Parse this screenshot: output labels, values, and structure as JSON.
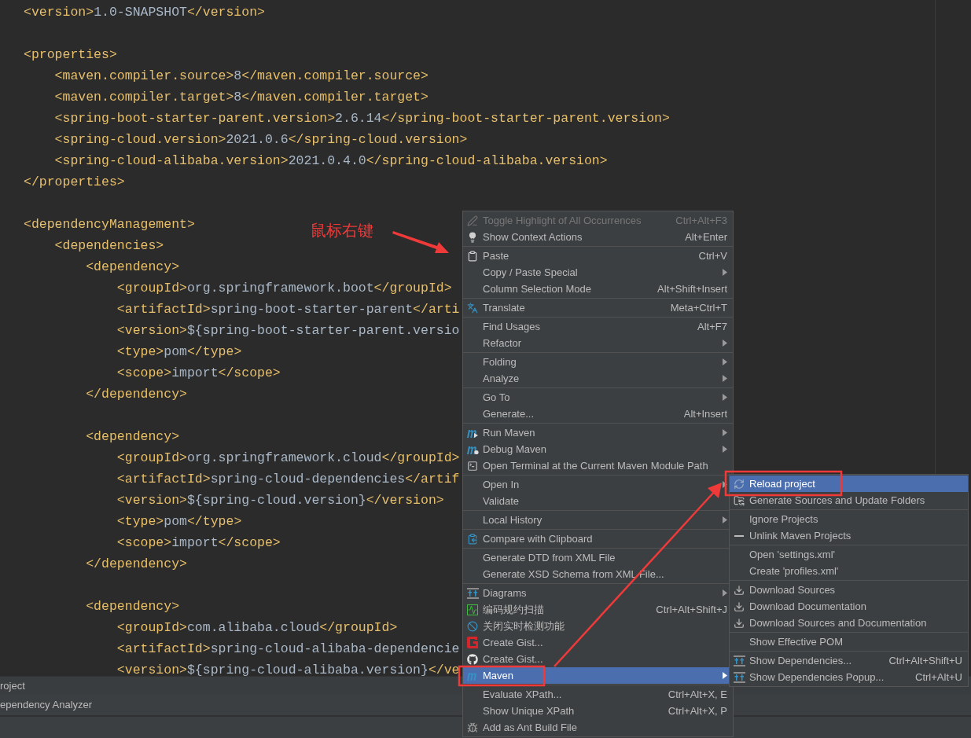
{
  "editor": {
    "blocks": [
      {
        "lines": [
          "<version>1.0-SNAPSHOT</version>"
        ]
      },
      {
        "lines": [
          "<properties>",
          "    <maven.compiler.source>8</maven.compiler.source>",
          "    <maven.compiler.target>8</maven.compiler.target>",
          "    <spring-boot-starter-parent.version>2.6.14</spring-boot-starter-parent.version>",
          "    <spring-cloud.version>2021.0.6</spring-cloud.version>",
          "    <spring-cloud-alibaba.version>2021.0.4.0</spring-cloud-alibaba.version>",
          "</properties>"
        ]
      },
      {
        "lines": [
          "<dependencyManagement>",
          "    <dependencies>",
          "        <dependency>",
          "            <groupId>org.springframework.boot</groupId>",
          "            <artifactId>spring-boot-starter-parent</arti",
          "            <version>${spring-boot-starter-parent.versio",
          "            <type>pom</type>",
          "            <scope>import</scope>",
          "        </dependency>"
        ]
      },
      {
        "lines": [
          "        <dependency>",
          "            <groupId>org.springframework.cloud</groupId>",
          "            <artifactId>spring-cloud-dependencies</artif",
          "            <version>${spring-cloud.version}</version>",
          "            <type>pom</type>",
          "            <scope>import</scope>",
          "        </dependency>"
        ]
      },
      {
        "lines": [
          "        <dependency>",
          "            <groupId>com.alibaba.cloud</groupId>",
          "            <artifactId>spring-cloud-alibaba-dependencie",
          "            <version>${spring-cloud-alibaba.version}</ve"
        ]
      }
    ]
  },
  "tool_windows": [
    {
      "label": "roject"
    },
    {
      "label": "ependency Analyzer"
    }
  ],
  "annotations": [
    {
      "text": "鼠标右键"
    }
  ],
  "context_menu": {
    "sections": [
      {
        "items": [
          {
            "label": "Toggle Highlight of All Occurrences",
            "shortcut": "Ctrl+Alt+F3",
            "submenu": false,
            "disabled": true,
            "selected": false
          },
          {
            "label": "Show Context Actions",
            "shortcut": "Alt+Enter",
            "submenu": false,
            "disabled": false,
            "selected": false
          }
        ]
      },
      {
        "items": [
          {
            "label": "Paste",
            "shortcut": "Ctrl+V",
            "submenu": false,
            "disabled": false,
            "selected": false
          },
          {
            "label": "Copy / Paste Special",
            "submenu": true,
            "disabled": false,
            "selected": false
          },
          {
            "label": "Column Selection Mode",
            "shortcut": "Alt+Shift+Insert",
            "submenu": false,
            "disabled": false,
            "selected": false
          }
        ]
      },
      {
        "items": [
          {
            "label": "Translate",
            "shortcut": "Meta+Ctrl+T",
            "submenu": false,
            "disabled": false,
            "selected": false
          }
        ]
      },
      {
        "items": [
          {
            "label": "Find Usages",
            "shortcut": "Alt+F7",
            "submenu": false,
            "disabled": false,
            "selected": false
          },
          {
            "label": "Refactor",
            "submenu": true,
            "disabled": false,
            "selected": false
          }
        ]
      },
      {
        "items": [
          {
            "label": "Folding",
            "submenu": true,
            "disabled": false,
            "selected": false
          },
          {
            "label": "Analyze",
            "submenu": true,
            "disabled": false,
            "selected": false
          }
        ]
      },
      {
        "items": [
          {
            "label": "Go To",
            "submenu": true,
            "disabled": false,
            "selected": false
          },
          {
            "label": "Generate...",
            "shortcut": "Alt+Insert",
            "submenu": false,
            "disabled": false,
            "selected": false
          }
        ]
      },
      {
        "items": [
          {
            "label": "Run Maven",
            "submenu": true,
            "disabled": false,
            "selected": false
          },
          {
            "label": "Debug Maven",
            "submenu": true,
            "disabled": false,
            "selected": false
          },
          {
            "label": "Open Terminal at the Current Maven Module Path",
            "submenu": false,
            "disabled": false,
            "selected": false
          }
        ]
      },
      {
        "items": [
          {
            "label": "Open In",
            "submenu": true,
            "disabled": false,
            "selected": false
          },
          {
            "label": "Validate",
            "submenu": false,
            "disabled": false,
            "selected": false
          }
        ]
      },
      {
        "items": [
          {
            "label": "Local History",
            "submenu": true,
            "disabled": false,
            "selected": false
          }
        ]
      },
      {
        "items": [
          {
            "label": "Compare with Clipboard",
            "submenu": false,
            "disabled": false,
            "selected": false
          }
        ]
      },
      {
        "items": [
          {
            "label": "Generate DTD from XML File",
            "submenu": false,
            "disabled": false,
            "selected": false
          },
          {
            "label": "Generate XSD Schema from XML File...",
            "submenu": false,
            "disabled": false,
            "selected": false
          }
        ]
      },
      {
        "items": [
          {
            "label": "Diagrams",
            "submenu": true,
            "disabled": false,
            "selected": false
          },
          {
            "label": "编码规约扫描",
            "shortcut": "Ctrl+Alt+Shift+J",
            "submenu": false,
            "disabled": false,
            "selected": false
          },
          {
            "label": "关闭实时检测功能",
            "submenu": false,
            "disabled": false,
            "selected": false
          },
          {
            "label": "Create Gist...",
            "submenu": false,
            "disabled": false,
            "selected": false
          },
          {
            "label": "Create Gist...",
            "submenu": false,
            "disabled": false,
            "selected": false
          },
          {
            "label": "Maven",
            "submenu": true,
            "disabled": false,
            "selected": true
          }
        ]
      },
      {
        "items": [
          {
            "label": "Evaluate XPath...",
            "shortcut": "Ctrl+Alt+X, E",
            "submenu": false,
            "disabled": false,
            "selected": false
          },
          {
            "label": "Show Unique XPath",
            "shortcut": "Ctrl+Alt+X, P",
            "submenu": false,
            "disabled": false,
            "selected": false
          },
          {
            "label": "Add as Ant Build File",
            "submenu": false,
            "disabled": false,
            "selected": false
          }
        ]
      }
    ]
  },
  "maven_submenu": {
    "sections": [
      {
        "items": [
          {
            "label": "Reload project",
            "submenu": false,
            "disabled": false,
            "selected": true
          },
          {
            "label": "Generate Sources and Update Folders",
            "submenu": false,
            "disabled": false,
            "selected": false
          }
        ]
      },
      {
        "items": [
          {
            "label": "Ignore Projects",
            "submenu": false,
            "disabled": false,
            "selected": false
          },
          {
            "label": "Unlink Maven Projects",
            "submenu": false,
            "disabled": false,
            "selected": false
          }
        ]
      },
      {
        "items": [
          {
            "label": "Open 'settings.xml'",
            "submenu": false,
            "disabled": false,
            "selected": false
          },
          {
            "label": "Create 'profiles.xml'",
            "submenu": false,
            "disabled": false,
            "selected": false
          }
        ]
      },
      {
        "items": [
          {
            "label": "Download Sources",
            "submenu": false,
            "disabled": false,
            "selected": false
          },
          {
            "label": "Download Documentation",
            "submenu": false,
            "disabled": false,
            "selected": false
          },
          {
            "label": "Download Sources and Documentation",
            "submenu": false,
            "disabled": false,
            "selected": false
          }
        ]
      },
      {
        "items": [
          {
            "label": "Show Effective POM",
            "submenu": false,
            "disabled": false,
            "selected": false
          }
        ]
      },
      {
        "items": [
          {
            "label": "Show Dependencies...",
            "shortcut": "Ctrl+Alt+Shift+U",
            "submenu": false,
            "disabled": false,
            "selected": false
          },
          {
            "label": "Show Dependencies Popup...",
            "shortcut": "Ctrl+Alt+U",
            "submenu": false,
            "disabled": false,
            "selected": false
          }
        ]
      }
    ]
  }
}
